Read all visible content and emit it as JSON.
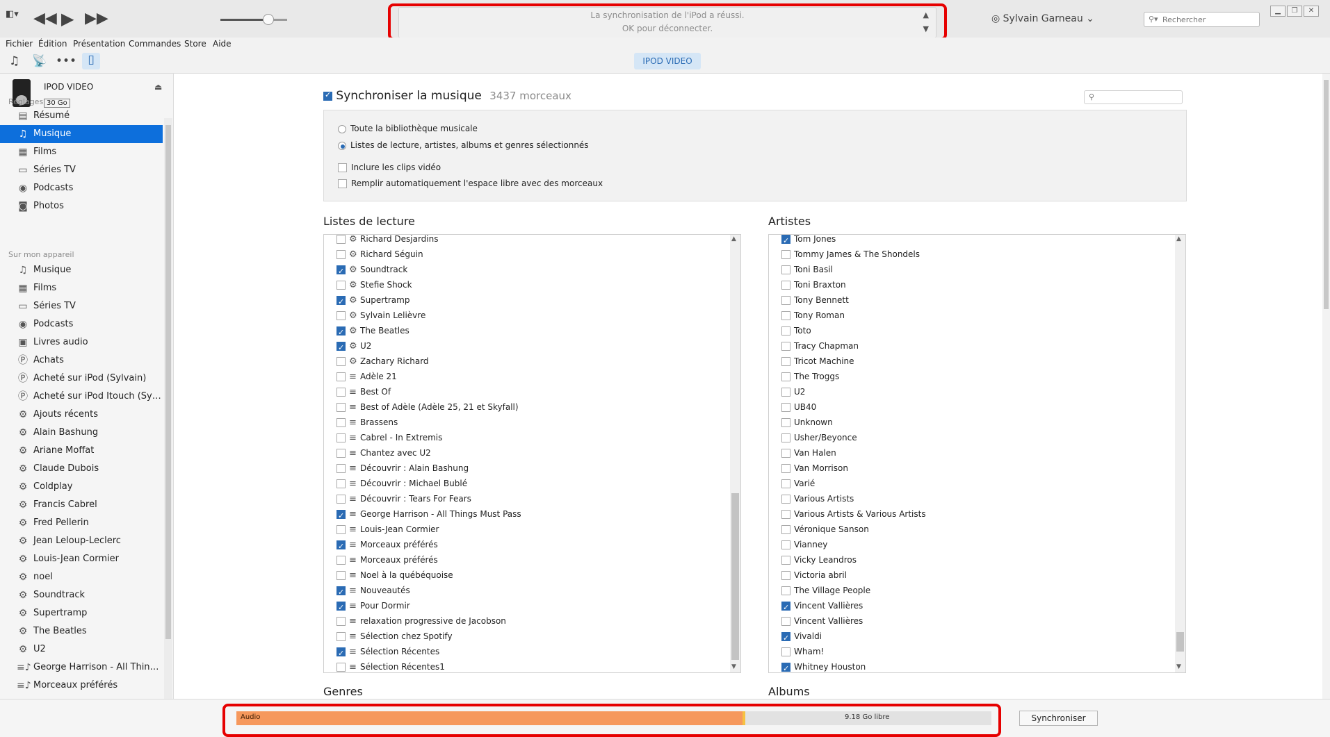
{
  "titlebar": {
    "menu_icon": "window-menu-icon",
    "lcd_line1": "La synchronisation de l'iPod a réussi.",
    "lcd_line2": "OK pour déconnecter.",
    "user": "Sylvain Garneau ⌄",
    "search_placeholder": "Rechercher"
  },
  "menu": [
    "Fichier",
    "Édition",
    "Présentation",
    "Commandes",
    "Store",
    "Aide"
  ],
  "toolbar": {
    "device_badge": "IPOD VIDEO"
  },
  "device": {
    "name": "IPOD VIDEO",
    "capacity": "30 Go"
  },
  "sidebar": {
    "settings_header": "Réglages",
    "settings": [
      {
        "label": "Résumé",
        "icon": "summary-icon",
        "glyph": "▤"
      },
      {
        "label": "Musique",
        "icon": "music-note-icon",
        "glyph": "♫",
        "selected": true
      },
      {
        "label": "Films",
        "icon": "film-icon",
        "glyph": "▦"
      },
      {
        "label": "Séries TV",
        "icon": "tv-icon",
        "glyph": "▭"
      },
      {
        "label": "Podcasts",
        "icon": "podcast-icon",
        "glyph": "◉"
      },
      {
        "label": "Photos",
        "icon": "camera-icon",
        "glyph": "◙"
      }
    ],
    "device_header": "Sur mon appareil",
    "device_items": [
      {
        "label": "Musique",
        "icon": "music-note-icon",
        "glyph": "♫"
      },
      {
        "label": "Films",
        "icon": "film-icon",
        "glyph": "▦"
      },
      {
        "label": "Séries TV",
        "icon": "tv-icon",
        "glyph": "▭"
      },
      {
        "label": "Podcasts",
        "icon": "podcast-icon",
        "glyph": "◉"
      },
      {
        "label": "Livres audio",
        "icon": "audiobook-icon",
        "glyph": "▣"
      },
      {
        "label": "Achats",
        "icon": "purchase-icon",
        "glyph": "Ⓟ"
      },
      {
        "label": "Acheté sur iPod (Sylvain)",
        "icon": "purchase-icon",
        "glyph": "Ⓟ"
      },
      {
        "label": "Acheté sur iPod Itouch (Syl...",
        "icon": "purchase-icon",
        "glyph": "Ⓟ"
      },
      {
        "label": "Ajouts récents",
        "icon": "smart-playlist-gear-icon",
        "glyph": "⚙"
      },
      {
        "label": "Alain Bashung",
        "icon": "smart-playlist-gear-icon",
        "glyph": "⚙"
      },
      {
        "label": "Ariane Moffat",
        "icon": "smart-playlist-gear-icon",
        "glyph": "⚙"
      },
      {
        "label": "Claude Dubois",
        "icon": "smart-playlist-gear-icon",
        "glyph": "⚙"
      },
      {
        "label": "Coldplay",
        "icon": "smart-playlist-gear-icon",
        "glyph": "⚙"
      },
      {
        "label": "Francis Cabrel",
        "icon": "smart-playlist-gear-icon",
        "glyph": "⚙"
      },
      {
        "label": "Fred Pellerin",
        "icon": "smart-playlist-gear-icon",
        "glyph": "⚙"
      },
      {
        "label": "Jean Leloup-Leclerc",
        "icon": "smart-playlist-gear-icon",
        "glyph": "⚙"
      },
      {
        "label": "Louis-Jean Cormier",
        "icon": "smart-playlist-gear-icon",
        "glyph": "⚙"
      },
      {
        "label": "noel",
        "icon": "smart-playlist-gear-icon",
        "glyph": "⚙"
      },
      {
        "label": "Soundtrack",
        "icon": "smart-playlist-gear-icon",
        "glyph": "⚙"
      },
      {
        "label": "Supertramp",
        "icon": "smart-playlist-gear-icon",
        "glyph": "⚙"
      },
      {
        "label": "The Beatles",
        "icon": "smart-playlist-gear-icon",
        "glyph": "⚙"
      },
      {
        "label": "U2",
        "icon": "smart-playlist-gear-icon",
        "glyph": "⚙"
      },
      {
        "label": "George Harrison - All Thing...",
        "icon": "playlist-icon",
        "glyph": "≡♪"
      },
      {
        "label": "Morceaux préférés",
        "icon": "playlist-icon",
        "glyph": "≡♪"
      }
    ]
  },
  "main": {
    "sync_label": "Synchroniser la musique",
    "sync_checked": true,
    "track_count": "3437 morceaux",
    "options": {
      "whole_library": "Toute la bibliothèque musicale",
      "selected": "Listes de lecture, artistes, albums et genres sélectionnés",
      "include_videos": "Inclure les clips vidéo",
      "autofill": "Remplir automatiquement l'espace libre avec des morceaux"
    },
    "playlists_title": "Listes de lecture",
    "artists_title": "Artistes",
    "genres_title": "Genres",
    "albums_title": "Albums",
    "playlists": [
      {
        "label": "Richard Desjardins",
        "checked": false,
        "type": "smart"
      },
      {
        "label": "Richard Séguin",
        "checked": false,
        "type": "smart"
      },
      {
        "label": "Soundtrack",
        "checked": true,
        "type": "smart"
      },
      {
        "label": "Stefie Shock",
        "checked": false,
        "type": "smart"
      },
      {
        "label": "Supertramp",
        "checked": true,
        "type": "smart"
      },
      {
        "label": "Sylvain Lelièvre",
        "checked": false,
        "type": "smart"
      },
      {
        "label": "The Beatles",
        "checked": true,
        "type": "smart"
      },
      {
        "label": "U2",
        "checked": true,
        "type": "smart"
      },
      {
        "label": "Zachary Richard",
        "checked": false,
        "type": "smart"
      },
      {
        "label": "Adèle 21",
        "checked": false,
        "type": "playlist"
      },
      {
        "label": "Best Of",
        "checked": false,
        "type": "playlist"
      },
      {
        "label": "Best of Adèle (Adèle 25, 21 et Skyfall)",
        "checked": false,
        "type": "playlist"
      },
      {
        "label": "Brassens",
        "checked": false,
        "type": "playlist"
      },
      {
        "label": "Cabrel - In Extremis",
        "checked": false,
        "type": "playlist"
      },
      {
        "label": "Chantez avec U2",
        "checked": false,
        "type": "playlist"
      },
      {
        "label": "Découvrir : Alain Bashung",
        "checked": false,
        "type": "playlist"
      },
      {
        "label": "Découvrir : Michael Bublé",
        "checked": false,
        "type": "playlist"
      },
      {
        "label": "Découvrir : Tears For Fears",
        "checked": false,
        "type": "playlist"
      },
      {
        "label": "George Harrison - All Things Must Pass",
        "checked": true,
        "type": "playlist"
      },
      {
        "label": "Louis-Jean Cormier",
        "checked": false,
        "type": "playlist"
      },
      {
        "label": "Morceaux préférés",
        "checked": true,
        "type": "playlist"
      },
      {
        "label": "Morceaux préférés",
        "checked": false,
        "type": "playlist"
      },
      {
        "label": "Noel à la québéquoise",
        "checked": false,
        "type": "playlist"
      },
      {
        "label": "Nouveautés",
        "checked": true,
        "type": "playlist"
      },
      {
        "label": "Pour Dormir",
        "checked": true,
        "type": "playlist"
      },
      {
        "label": "relaxation progressive de Jacobson",
        "checked": false,
        "type": "playlist"
      },
      {
        "label": "Sélection chez Spotify",
        "checked": false,
        "type": "playlist"
      },
      {
        "label": "Sélection Récentes",
        "checked": true,
        "type": "playlist"
      },
      {
        "label": "Sélection Récentes1",
        "checked": false,
        "type": "playlist"
      }
    ],
    "artists": [
      {
        "label": "Tom Jones",
        "checked": true
      },
      {
        "label": "Tommy James & The Shondels",
        "checked": false
      },
      {
        "label": "Toni Basil",
        "checked": false
      },
      {
        "label": "Toni Braxton",
        "checked": false
      },
      {
        "label": "Tony Bennett",
        "checked": false
      },
      {
        "label": "Tony Roman",
        "checked": false
      },
      {
        "label": "Toto",
        "checked": false
      },
      {
        "label": "Tracy Chapman",
        "checked": false
      },
      {
        "label": "Tricot Machine",
        "checked": false
      },
      {
        "label": "The Troggs",
        "checked": false
      },
      {
        "label": "U2",
        "checked": false
      },
      {
        "label": "UB40",
        "checked": false
      },
      {
        "label": "Unknown",
        "checked": false
      },
      {
        "label": "Usher/Beyonce",
        "checked": false
      },
      {
        "label": "Van Halen",
        "checked": false
      },
      {
        "label": "Van Morrison",
        "checked": false
      },
      {
        "label": "Varié",
        "checked": false
      },
      {
        "label": "Various Artists",
        "checked": false
      },
      {
        "label": "Various Artists & Various Artists",
        "checked": false
      },
      {
        "label": "Véronique Sanson",
        "checked": false
      },
      {
        "label": "Vianney",
        "checked": false
      },
      {
        "label": "Vicky Leandros",
        "checked": false
      },
      {
        "label": "Victoria abril",
        "checked": false
      },
      {
        "label": "The Village People",
        "checked": false
      },
      {
        "label": "Vincent Vallières",
        "checked": true
      },
      {
        "label": "Vincent Vallières",
        "checked": false
      },
      {
        "label": "Vivaldi",
        "checked": true
      },
      {
        "label": "Wham!",
        "checked": false
      },
      {
        "label": "Whitney Houston",
        "checked": true
      }
    ]
  },
  "capacity_bar": {
    "audio_label": "Audio",
    "free_label": "9.18 Go libre",
    "audio_fraction": 0.67,
    "audio_color": "#f6985c",
    "other_color": "#f6c142"
  },
  "sync_button": "Synchroniser",
  "colors": {
    "selection": "#0d6fdc",
    "accent": "#2a6bb4",
    "highlight_border": "#e60000"
  }
}
